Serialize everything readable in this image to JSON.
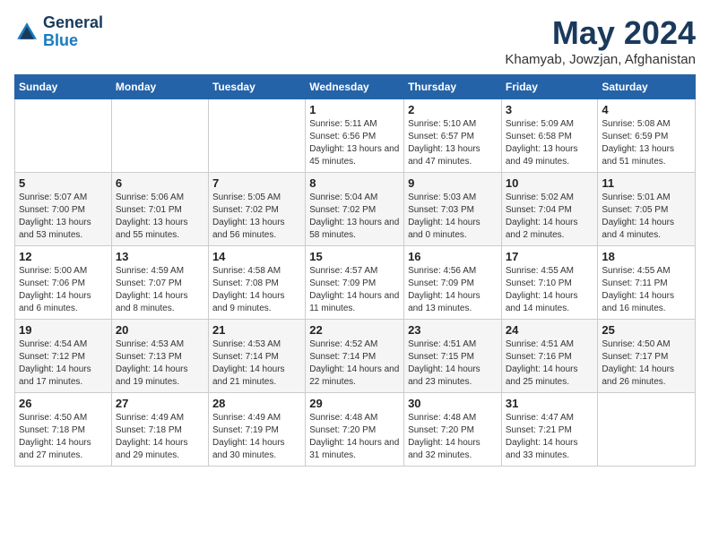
{
  "header": {
    "logo_line1": "General",
    "logo_line2": "Blue",
    "month": "May 2024",
    "location": "Khamyab, Jowzjan, Afghanistan"
  },
  "weekdays": [
    "Sunday",
    "Monday",
    "Tuesday",
    "Wednesday",
    "Thursday",
    "Friday",
    "Saturday"
  ],
  "weeks": [
    [
      {
        "day": "",
        "info": ""
      },
      {
        "day": "",
        "info": ""
      },
      {
        "day": "",
        "info": ""
      },
      {
        "day": "1",
        "info": "Sunrise: 5:11 AM\nSunset: 6:56 PM\nDaylight: 13 hours and 45 minutes."
      },
      {
        "day": "2",
        "info": "Sunrise: 5:10 AM\nSunset: 6:57 PM\nDaylight: 13 hours and 47 minutes."
      },
      {
        "day": "3",
        "info": "Sunrise: 5:09 AM\nSunset: 6:58 PM\nDaylight: 13 hours and 49 minutes."
      },
      {
        "day": "4",
        "info": "Sunrise: 5:08 AM\nSunset: 6:59 PM\nDaylight: 13 hours and 51 minutes."
      }
    ],
    [
      {
        "day": "5",
        "info": "Sunrise: 5:07 AM\nSunset: 7:00 PM\nDaylight: 13 hours and 53 minutes."
      },
      {
        "day": "6",
        "info": "Sunrise: 5:06 AM\nSunset: 7:01 PM\nDaylight: 13 hours and 55 minutes."
      },
      {
        "day": "7",
        "info": "Sunrise: 5:05 AM\nSunset: 7:02 PM\nDaylight: 13 hours and 56 minutes."
      },
      {
        "day": "8",
        "info": "Sunrise: 5:04 AM\nSunset: 7:02 PM\nDaylight: 13 hours and 58 minutes."
      },
      {
        "day": "9",
        "info": "Sunrise: 5:03 AM\nSunset: 7:03 PM\nDaylight: 14 hours and 0 minutes."
      },
      {
        "day": "10",
        "info": "Sunrise: 5:02 AM\nSunset: 7:04 PM\nDaylight: 14 hours and 2 minutes."
      },
      {
        "day": "11",
        "info": "Sunrise: 5:01 AM\nSunset: 7:05 PM\nDaylight: 14 hours and 4 minutes."
      }
    ],
    [
      {
        "day": "12",
        "info": "Sunrise: 5:00 AM\nSunset: 7:06 PM\nDaylight: 14 hours and 6 minutes."
      },
      {
        "day": "13",
        "info": "Sunrise: 4:59 AM\nSunset: 7:07 PM\nDaylight: 14 hours and 8 minutes."
      },
      {
        "day": "14",
        "info": "Sunrise: 4:58 AM\nSunset: 7:08 PM\nDaylight: 14 hours and 9 minutes."
      },
      {
        "day": "15",
        "info": "Sunrise: 4:57 AM\nSunset: 7:09 PM\nDaylight: 14 hours and 11 minutes."
      },
      {
        "day": "16",
        "info": "Sunrise: 4:56 AM\nSunset: 7:09 PM\nDaylight: 14 hours and 13 minutes."
      },
      {
        "day": "17",
        "info": "Sunrise: 4:55 AM\nSunset: 7:10 PM\nDaylight: 14 hours and 14 minutes."
      },
      {
        "day": "18",
        "info": "Sunrise: 4:55 AM\nSunset: 7:11 PM\nDaylight: 14 hours and 16 minutes."
      }
    ],
    [
      {
        "day": "19",
        "info": "Sunrise: 4:54 AM\nSunset: 7:12 PM\nDaylight: 14 hours and 17 minutes."
      },
      {
        "day": "20",
        "info": "Sunrise: 4:53 AM\nSunset: 7:13 PM\nDaylight: 14 hours and 19 minutes."
      },
      {
        "day": "21",
        "info": "Sunrise: 4:53 AM\nSunset: 7:14 PM\nDaylight: 14 hours and 21 minutes."
      },
      {
        "day": "22",
        "info": "Sunrise: 4:52 AM\nSunset: 7:14 PM\nDaylight: 14 hours and 22 minutes."
      },
      {
        "day": "23",
        "info": "Sunrise: 4:51 AM\nSunset: 7:15 PM\nDaylight: 14 hours and 23 minutes."
      },
      {
        "day": "24",
        "info": "Sunrise: 4:51 AM\nSunset: 7:16 PM\nDaylight: 14 hours and 25 minutes."
      },
      {
        "day": "25",
        "info": "Sunrise: 4:50 AM\nSunset: 7:17 PM\nDaylight: 14 hours and 26 minutes."
      }
    ],
    [
      {
        "day": "26",
        "info": "Sunrise: 4:50 AM\nSunset: 7:18 PM\nDaylight: 14 hours and 27 minutes."
      },
      {
        "day": "27",
        "info": "Sunrise: 4:49 AM\nSunset: 7:18 PM\nDaylight: 14 hours and 29 minutes."
      },
      {
        "day": "28",
        "info": "Sunrise: 4:49 AM\nSunset: 7:19 PM\nDaylight: 14 hours and 30 minutes."
      },
      {
        "day": "29",
        "info": "Sunrise: 4:48 AM\nSunset: 7:20 PM\nDaylight: 14 hours and 31 minutes."
      },
      {
        "day": "30",
        "info": "Sunrise: 4:48 AM\nSunset: 7:20 PM\nDaylight: 14 hours and 32 minutes."
      },
      {
        "day": "31",
        "info": "Sunrise: 4:47 AM\nSunset: 7:21 PM\nDaylight: 14 hours and 33 minutes."
      },
      {
        "day": "",
        "info": ""
      }
    ]
  ]
}
